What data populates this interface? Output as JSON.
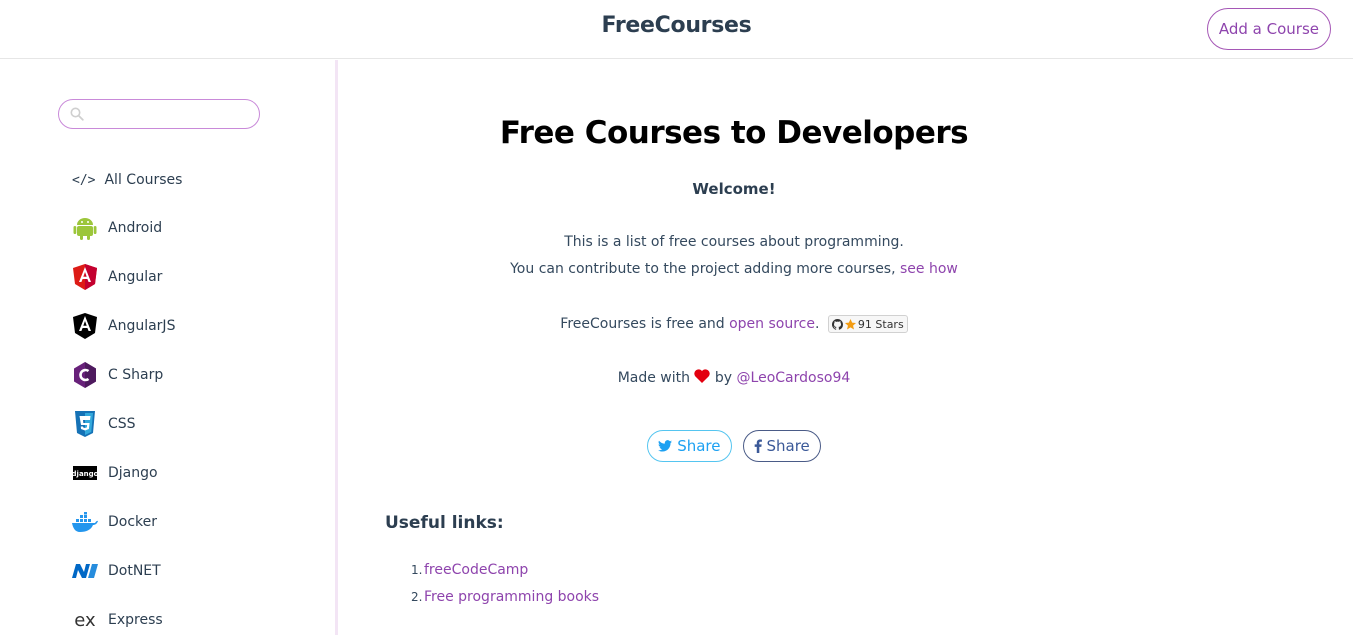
{
  "header": {
    "brand": "FreeCourses",
    "add_course": "Add a Course"
  },
  "sidebar": {
    "search_placeholder": "",
    "all_courses": {
      "icon": "code-icon",
      "label": "All Courses"
    },
    "items": [
      {
        "label": "Android",
        "icon": "android-icon"
      },
      {
        "label": "Angular",
        "icon": "angular-icon"
      },
      {
        "label": "AngularJS",
        "icon": "angularjs-icon"
      },
      {
        "label": "C Sharp",
        "icon": "csharp-icon"
      },
      {
        "label": "CSS",
        "icon": "css3-icon"
      },
      {
        "label": "Django",
        "icon": "django-icon"
      },
      {
        "label": "Docker",
        "icon": "docker-icon"
      },
      {
        "label": "DotNET",
        "icon": "dotnet-icon"
      },
      {
        "label": "Express",
        "icon": "express-icon"
      }
    ]
  },
  "main": {
    "title": "Free Courses to Developers",
    "welcome": "Welcome!",
    "intro_line1": "This is a list of free courses about programming.",
    "intro_line2": "You can contribute to the project adding more courses,",
    "see_how": "see how",
    "open_source_prefix": "FreeCourses is free and",
    "open_source_link": "open source",
    "open_source_suffix": ".",
    "stars_badge": "91 Stars",
    "made_with": "Made with",
    "by": "by",
    "author": "@LeoCardoso94",
    "share_twitter": "Share",
    "share_facebook": "Share",
    "useful_links_title": "Useful links:",
    "useful_links": [
      {
        "num": "1.",
        "label": "freeCodeCamp"
      },
      {
        "num": "2.",
        "label": "Free programming books"
      }
    ]
  },
  "colors": {
    "accent": "#8e44ad",
    "twitter": "#1da1f2",
    "facebook": "#3b5998",
    "heart": "#e3000f"
  }
}
